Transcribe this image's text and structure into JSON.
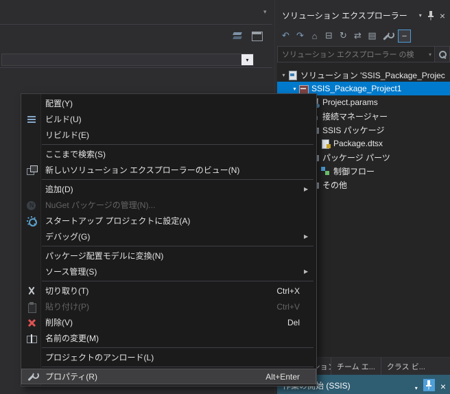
{
  "colors": {
    "selection_blue": "#007acc",
    "menu_highlight": "#3e3e40",
    "panel_header_teal": "#2f5d72",
    "delete_red": "#e05252",
    "focus_border_blue": "#4f9fd8"
  },
  "left_pane": {
    "overflow_chevron_glyph": "▾",
    "toolbar_icons": [
      {
        "name": "layers-icon"
      },
      {
        "name": "form-grid-icon"
      }
    ],
    "combo": {
      "value": "",
      "dropdown_glyph": "▾"
    }
  },
  "context_menu": {
    "submenu_arrow_glyph": "▶",
    "items": [
      {
        "label": "配置(Y)"
      },
      {
        "label": "ビルド(U)",
        "icon": "build-icon"
      },
      {
        "label": "リビルド(E)"
      },
      {
        "type": "separator"
      },
      {
        "label": "ここまで検索(S)"
      },
      {
        "label": "新しいソリューション エクスプローラーのビュー(N)",
        "icon": "new-view-icon"
      },
      {
        "type": "separator"
      },
      {
        "label": "追加(D)",
        "submenu": true
      },
      {
        "label": "NuGet パッケージの管理(N)...",
        "icon": "nuget-icon",
        "disabled": true
      },
      {
        "label": "スタートアップ プロジェクトに設定(A)",
        "icon": "gear-icon"
      },
      {
        "label": "デバッグ(G)",
        "submenu": true
      },
      {
        "type": "separator"
      },
      {
        "label": "パッケージ配置モデルに変換(N)"
      },
      {
        "label": "ソース管理(S)",
        "submenu": true
      },
      {
        "type": "separator"
      },
      {
        "label": "切り取り(T)",
        "icon": "cut-icon",
        "shortcut": "Ctrl+X"
      },
      {
        "label": "貼り付け(P)",
        "icon": "paste-icon",
        "shortcut": "Ctrl+V",
        "disabled": true
      },
      {
        "label": "削除(V)",
        "icon": "delete-icon",
        "shortcut": "Del"
      },
      {
        "label": "名前の変更(M)",
        "icon": "rename-icon"
      },
      {
        "type": "separator"
      },
      {
        "label": "プロジェクトのアンロード(L)"
      },
      {
        "type": "separator"
      },
      {
        "label": "プロパティ(R)",
        "icon": "wrench-icon",
        "shortcut": "Alt+Enter",
        "highlighted": true
      }
    ]
  },
  "solution_explorer": {
    "title": "ソリューション エクスプローラー",
    "title_buttons": {
      "dropdown_glyph": "▾",
      "close_glyph": "×"
    },
    "toolbar_icons": [
      {
        "name": "back-icon",
        "glyph": "↶",
        "blue": true
      },
      {
        "name": "forward-icon",
        "glyph": "↷",
        "blue": true
      },
      {
        "name": "home-icon",
        "glyph": "⌂"
      },
      {
        "name": "collapse-all-icon",
        "glyph": "⊟"
      },
      {
        "name": "sync-with-active-document-icon",
        "glyph": "↻"
      },
      {
        "name": "switch-views-icon",
        "glyph": "⇄"
      },
      {
        "name": "show-all-files-icon",
        "glyph": "▤"
      },
      {
        "name": "properties-icon",
        "glyph": ""
      },
      {
        "name": "preview-selected-items-toggle",
        "glyph": "−",
        "active": true
      }
    ],
    "search": {
      "placeholder": "ソリューション エクスプローラー の検",
      "dropdown_glyph": "▾"
    },
    "tree": [
      {
        "label": "ソリューション 'SSIS_Package_Projec",
        "icon": "solution-icon",
        "indent": 0,
        "expand": "expanded"
      },
      {
        "label": "SSIS_Package_Project1",
        "icon": "ssis-project-icon",
        "indent": 1,
        "expand": "expanded",
        "selected": true
      },
      {
        "label": "Project.params",
        "icon": "params-file-icon",
        "indent": 2
      },
      {
        "label": "接続マネージャー",
        "icon": "connection-managers-icon",
        "indent": 2,
        "expand": "collapsed"
      },
      {
        "label": "SSIS パッケージ",
        "icon": "folder-icon",
        "indent": 2,
        "expand": "expanded"
      },
      {
        "label": "Package.dtsx",
        "icon": "dtsx-file-icon",
        "indent": 3
      },
      {
        "label": "パッケージ パーツ",
        "icon": "folder-icon",
        "indent": 2,
        "expand": "expanded"
      },
      {
        "label": "制御フロー",
        "icon": "control-flow-icon",
        "indent": 3
      },
      {
        "label": "その他",
        "icon": "folder-icon",
        "indent": 2,
        "expand": "collapsed"
      }
    ],
    "bottom_tabs": [
      {
        "label": "ソリューション エ..."
      },
      {
        "label": "チーム エ..."
      },
      {
        "label": "クラス ビ..."
      }
    ]
  },
  "getting_started_panel": {
    "title": "作業の開始 (SSIS)",
    "buttons": {
      "dropdown_glyph": "▾",
      "close_glyph": "×"
    }
  }
}
